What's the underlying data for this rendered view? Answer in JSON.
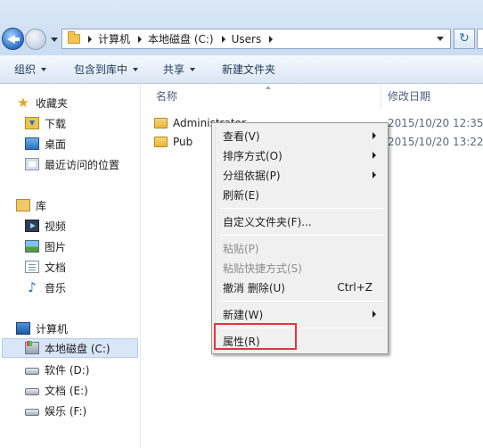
{
  "address": {
    "breadcrumbs": [
      "计算机",
      "本地磁盘 (C:)",
      "Users"
    ]
  },
  "toolbar": {
    "items": [
      "组织",
      "包含到库中",
      "共享",
      "新建文件夹"
    ]
  },
  "sidebar": {
    "favorites": {
      "label": "收藏夹",
      "items": [
        "下载",
        "桌面",
        "最近访问的位置"
      ]
    },
    "libraries": {
      "label": "库",
      "items": [
        "视频",
        "图片",
        "文档",
        "音乐"
      ]
    },
    "computer": {
      "label": "计算机",
      "items": [
        "本地磁盘 (C:)",
        "软件 (D:)",
        "文档 (E:)",
        "娱乐 (F:)"
      ]
    },
    "selected": "本地磁盘 (C:)"
  },
  "columns": {
    "name": "名称",
    "modified": "修改日期"
  },
  "files": [
    {
      "name": "Administrator",
      "modified": "2015/10/20 12:35"
    },
    {
      "name": "Pub",
      "modified": "2015/10/20 13:22"
    }
  ],
  "context_menu": {
    "items": [
      {
        "label": "查看(V)",
        "submenu": true
      },
      {
        "label": "排序方式(O)",
        "submenu": true
      },
      {
        "label": "分组依据(P)",
        "submenu": true
      },
      {
        "label": "刷新(E)"
      },
      {
        "label": "自定义文件夹(F)..."
      },
      {
        "label": "粘贴(P)",
        "disabled": true
      },
      {
        "label": "粘贴快捷方式(S)",
        "disabled": true
      },
      {
        "label": "撤消 删除(U)",
        "shortcut": "Ctrl+Z"
      },
      {
        "label": "新建(W)",
        "submenu": true
      },
      {
        "label": "属性(R)"
      }
    ]
  },
  "colors": {
    "highlight_box": "#e0363d",
    "selection": "#d8e6f7"
  }
}
